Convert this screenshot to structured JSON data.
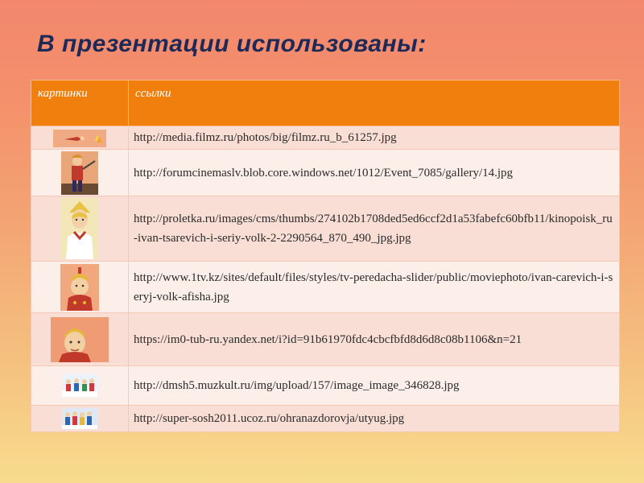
{
  "slide": {
    "title": "В презентации использованы:"
  },
  "table": {
    "headers": [
      "картинки",
      "ссылки"
    ],
    "rows": [
      {
        "thumb": "flying-hero-thumbnail",
        "link": "http://media.filmz.ru/photos/big/filmz.ru_b_61257.jpg"
      },
      {
        "thumb": "hero-with-sword-thumbnail",
        "link": "http://forumcinemaslv.blob.core.windows.net/1012/Event_7085/gallery/14.jpg"
      },
      {
        "thumb": "tsarevich-portrait-thumbnail",
        "link": "http://proletka.ru/images/cms/thumbs/274102b1708ded5ed6ccf2d1a53fabefc60bfb11/kinopoisk_ru-ivan-tsarevich-i-seriy-volk-2-2290564_870_490_jpg.jpg"
      },
      {
        "thumb": "hero-helmet-thumbnail",
        "link": "http://www.1tv.kz/sites/default/files/styles/tv-peredacha-slider/public/moviephoto/ivan-carevich-i-seryj-volk-afisha.jpg"
      },
      {
        "thumb": "hero-closeup-thumbnail",
        "link": "https://im0-tub-ru.yandex.net/i?id=91b61970fdc4cbcfbfd8d6d8c08b1106&n=21"
      },
      {
        "thumb": "kids-winter-thumbnail",
        "link": "http://dmsh5.muzkult.ru/img/upload/157/image_image_346828.jpg"
      },
      {
        "thumb": "kids-group-thumbnail",
        "link": "http://super-sosh2011.ucoz.ru/ohranazdorovja/utyug.jpg"
      }
    ]
  }
}
